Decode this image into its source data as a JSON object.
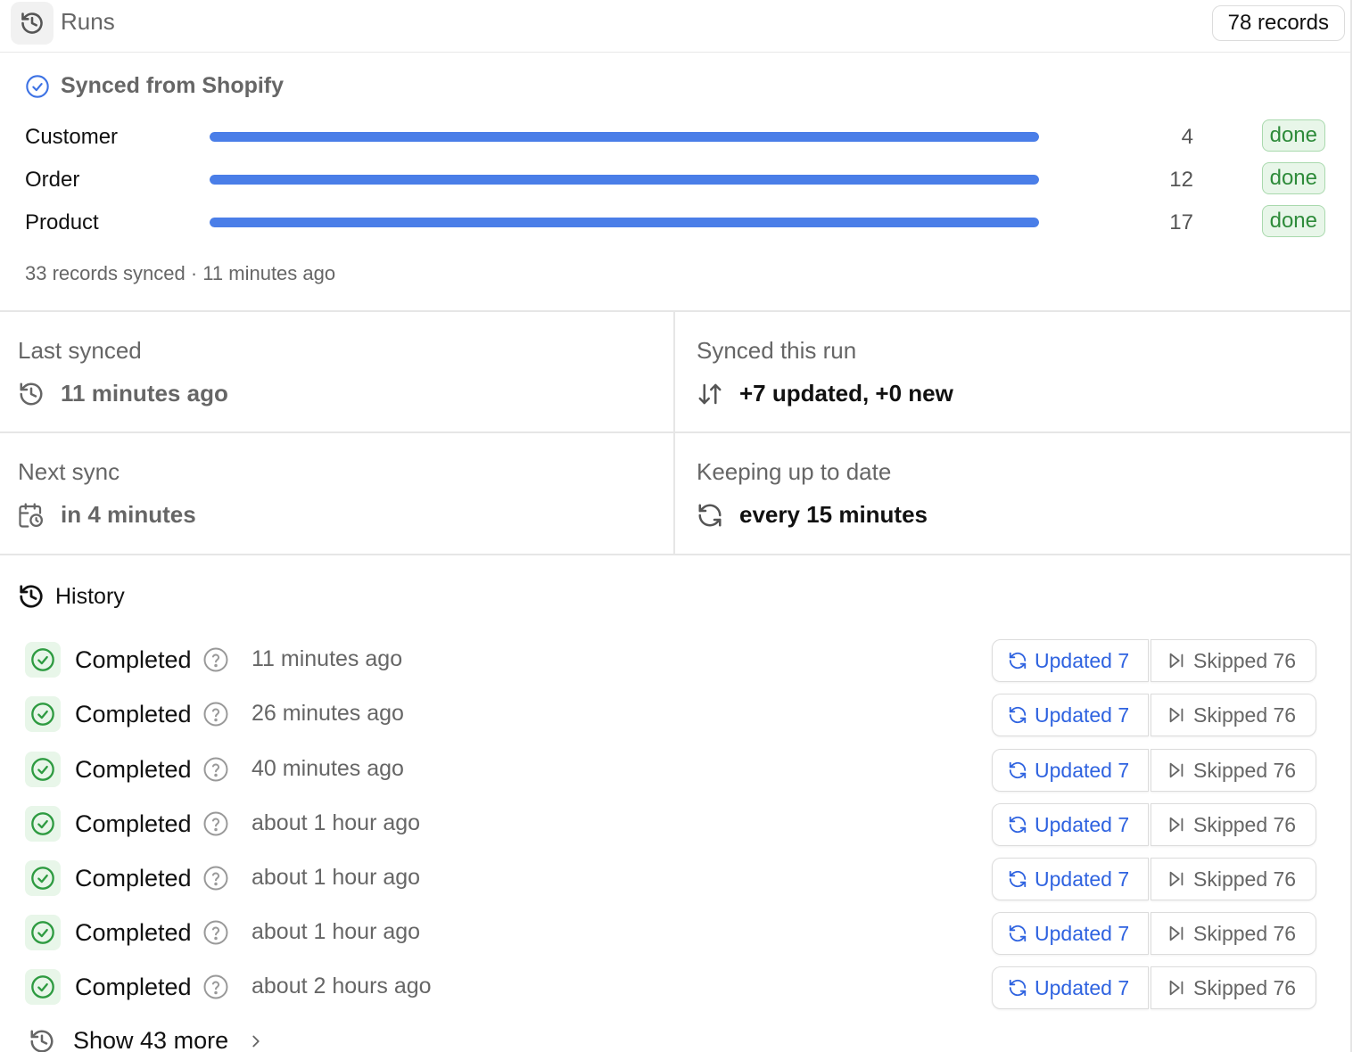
{
  "header": {
    "title": "Runs",
    "records_badge": "78 records"
  },
  "sync_source": {
    "title": "Synced from Shopify",
    "objects": [
      {
        "label": "Customer",
        "count": "4",
        "status": "done",
        "progress": 1.0
      },
      {
        "label": "Order",
        "count": "12",
        "status": "done",
        "progress": 1.0
      },
      {
        "label": "Product",
        "count": "17",
        "status": "done",
        "progress": 1.0
      }
    ],
    "summary": "33 records synced · 11 minutes ago"
  },
  "stats": {
    "last_synced": {
      "label": "Last synced",
      "value": "11 minutes ago"
    },
    "synced_this_run": {
      "label": "Synced this run",
      "value": "+7 updated, +0 new"
    },
    "next_sync": {
      "label": "Next sync",
      "value": "in 4 minutes"
    },
    "keeping_up": {
      "label": "Keeping up to date",
      "value": "every 15 minutes"
    }
  },
  "history": {
    "title": "History",
    "runs": [
      {
        "status": "Completed",
        "time": "11 minutes ago",
        "updated": "Updated 7",
        "skipped": "Skipped 76"
      },
      {
        "status": "Completed",
        "time": "26 minutes ago",
        "updated": "Updated 7",
        "skipped": "Skipped 76"
      },
      {
        "status": "Completed",
        "time": "40 minutes ago",
        "updated": "Updated 7",
        "skipped": "Skipped 76"
      },
      {
        "status": "Completed",
        "time": "about 1 hour ago",
        "updated": "Updated 7",
        "skipped": "Skipped 76"
      },
      {
        "status": "Completed",
        "time": "about 1 hour ago",
        "updated": "Updated 7",
        "skipped": "Skipped 76"
      },
      {
        "status": "Completed",
        "time": "about 1 hour ago",
        "updated": "Updated 7",
        "skipped": "Skipped 76"
      },
      {
        "status": "Completed",
        "time": "about 2 hours ago",
        "updated": "Updated 7",
        "skipped": "Skipped 76"
      }
    ],
    "show_more": "Show 43 more"
  },
  "colors": {
    "accent": "#4a7ee8",
    "link": "#2f63e0",
    "success": "#2e8b3a",
    "success_bg": "#e8f6e9"
  },
  "icons": [
    "history-icon",
    "check-circle-icon",
    "arrows-up-down-icon",
    "calendar-clock-icon",
    "refresh-icon",
    "help-icon",
    "skip-forward-icon",
    "chevron-right-icon"
  ]
}
